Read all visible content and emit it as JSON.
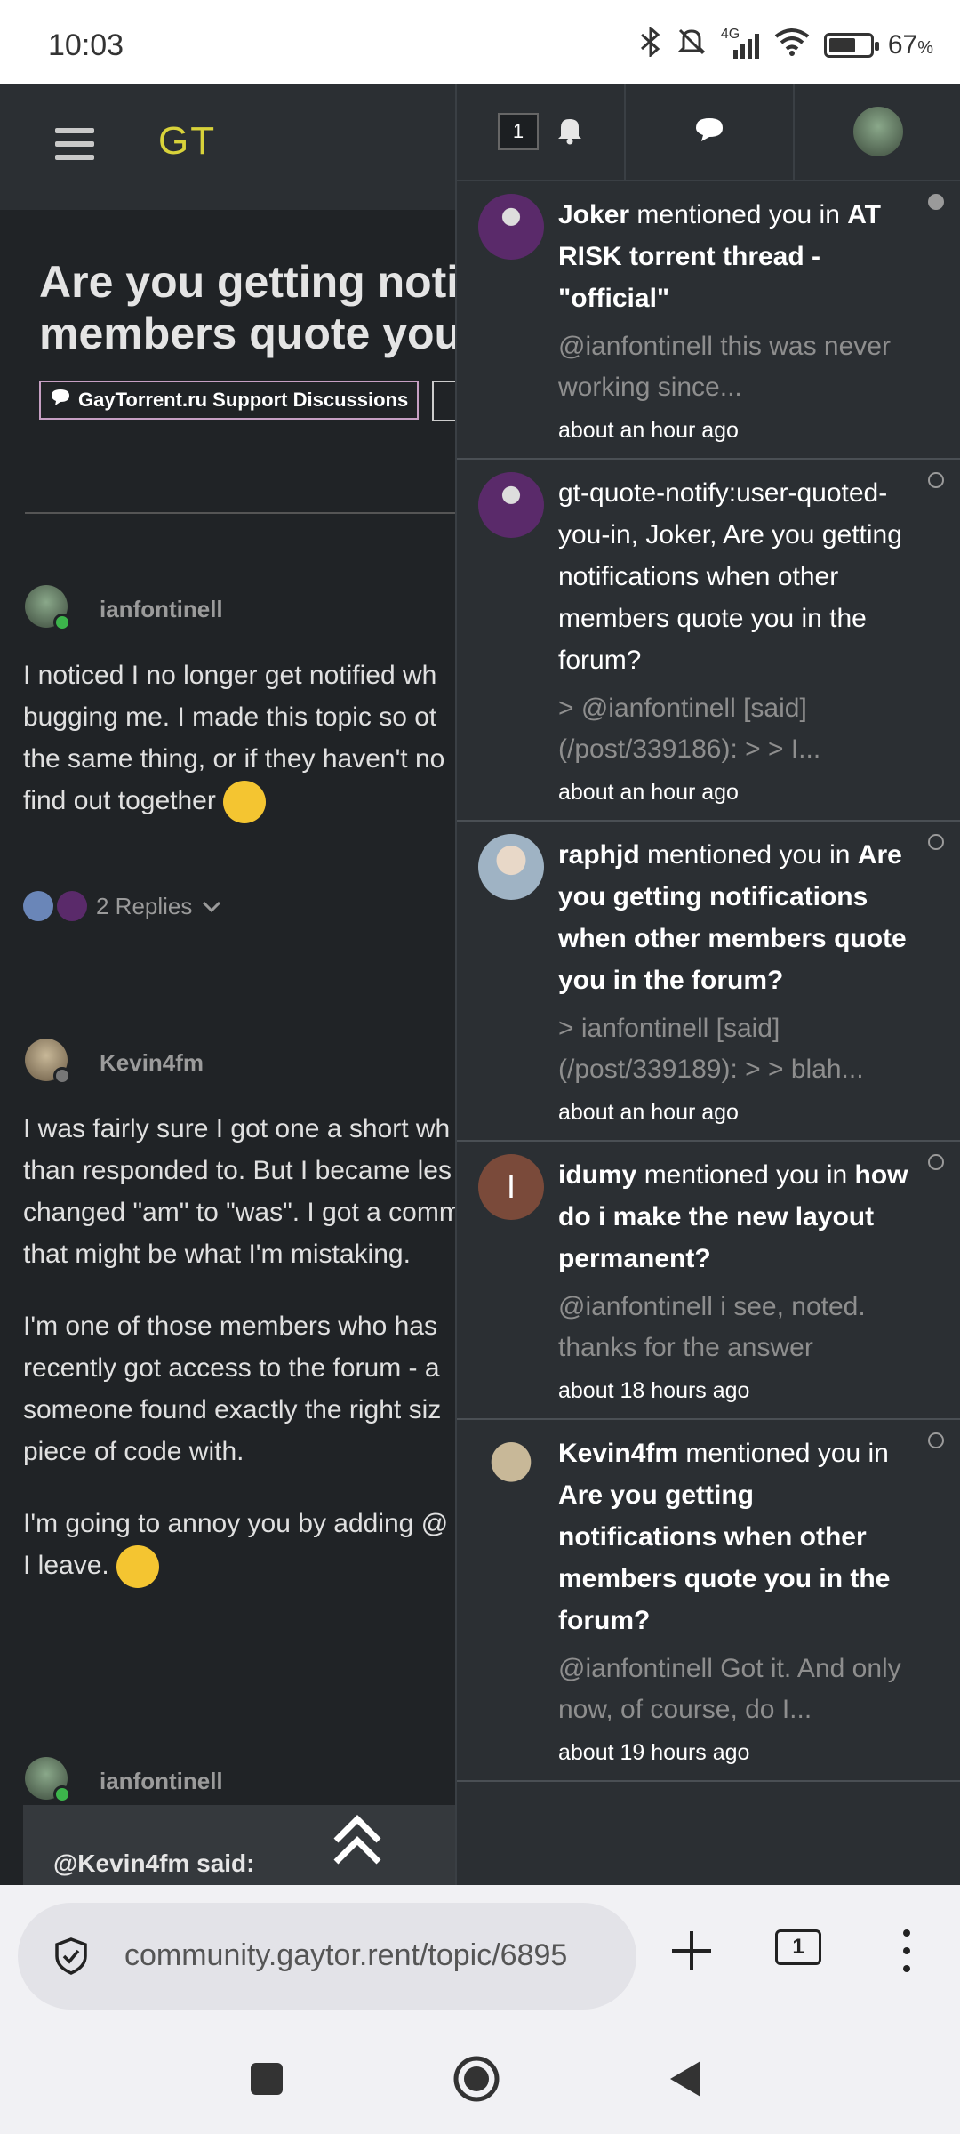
{
  "status_bar": {
    "time": "10:03",
    "network": "4G",
    "battery_percent": "67",
    "battery_level": 0.67
  },
  "header": {
    "logo": "GT"
  },
  "topic": {
    "title_line1": "Are you getting notifi",
    "title_line2": "members quote you i",
    "category": "GayTorrent.ru Support Discussions"
  },
  "posts": [
    {
      "author": "ianfontinell",
      "lines": [
        "I noticed I no longer get notified wh",
        "bugging me. I made this topic so ot",
        "the same thing, or if they haven't no",
        "find out together"
      ],
      "replies_label": "2 Replies"
    },
    {
      "author": "Kevin4fm",
      "paragraphs": [
        [
          "I was fairly sure I got one a short wh",
          "than responded to. But I became les",
          "changed \"am\" to \"was\". I got a comm",
          "that might be what I'm mistaking."
        ],
        [
          "I'm one of those members who has",
          "recently got access to the forum - a",
          "someone found exactly the right siz",
          "piece of code with."
        ],
        [
          "I'm going to annoy you by adding @",
          "I leave."
        ]
      ]
    },
    {
      "author": "ianfontinell",
      "quote_said": "@Kevin4fm said:"
    }
  ],
  "notifications_panel": {
    "unread_count": "1",
    "items": [
      {
        "user": "Joker",
        "action": " mentioned you in ",
        "topic": "AT RISK torrent thread - \"official\"",
        "excerpt": "@ianfontinell this was never working since...",
        "time": "about an hour ago",
        "unread": true,
        "avatar_color": "#5a2a6a"
      },
      {
        "user": "",
        "action": "gt-quote-notify:user-quoted-you-in, Joker, Are you getting notifications when other members quote you in the forum?",
        "topic": "",
        "excerpt": "> @ianfontinell [said](/post/339186): > > I...",
        "time": "about an hour ago",
        "unread": false,
        "avatar_color": "#5a2a6a"
      },
      {
        "user": "raphjd",
        "action": " mentioned you in ",
        "topic": "Are you getting notifications when other members quote you in the forum?",
        "excerpt": "> ianfontinell [said](/post/339189): > > blah...",
        "time": "about an hour ago",
        "unread": false,
        "avatar_color": "#9fb3c4"
      },
      {
        "user": "idumy",
        "action": " mentioned you in ",
        "topic": "how do i make the new layout permanent?",
        "excerpt": "@ianfontinell i see, noted. thanks for the answer",
        "time": "about 18 hours ago",
        "unread": false,
        "avatar_color": "#7a4a3a",
        "avatar_letter": "I"
      },
      {
        "user": "Kevin4fm",
        "action": " mentioned you in ",
        "topic": "Are you getting notifications when other members quote you in the forum?",
        "excerpt": "@ianfontinell Got it. And only now, of course, do I...",
        "time": "about 19 hours ago",
        "unread": false,
        "avatar_color": "#b8a88a"
      }
    ]
  },
  "browser": {
    "url": "community.gaytor.rent/topic/6895",
    "tab_count": "1"
  }
}
